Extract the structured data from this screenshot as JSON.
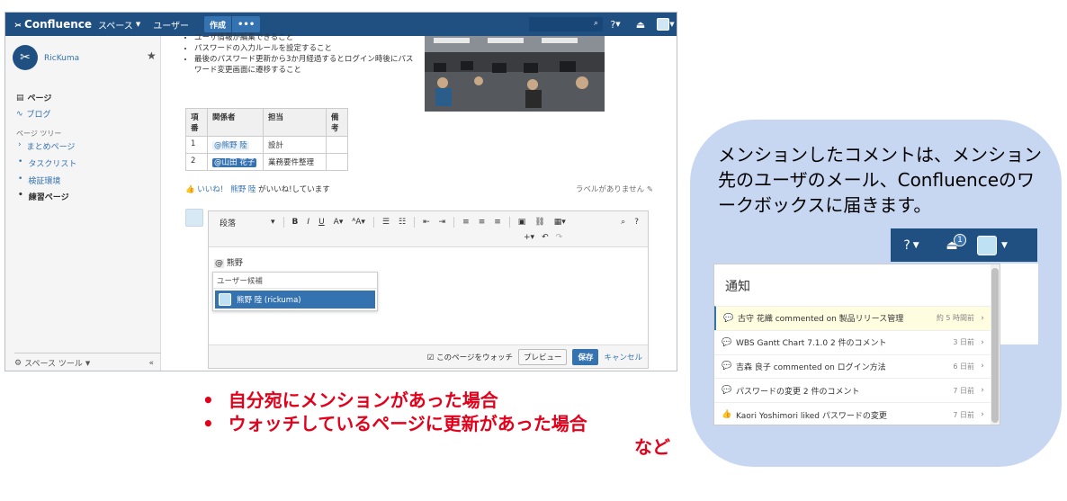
{
  "topbar": {
    "logo": "Confluence",
    "spaces": "スペース",
    "users": "ユーザー",
    "create": "作成",
    "more": "•••",
    "search_icon": "search-icon",
    "help": "?",
    "notifications_icon": "bell-icon"
  },
  "sidebar": {
    "space_name": "RicKuma",
    "pages": "ページ",
    "blog": "ブログ",
    "tree_title": "ページ ツリー",
    "tree_items": [
      "まとめページ",
      "タスクリスト",
      "検証環境",
      "練習ページ"
    ],
    "space_tools": "スペース ツール"
  },
  "content": {
    "bullets": [
      "ユーザ情報が編集できること",
      "パスワードの入力ルールを設定すること",
      "最後のパスワード更新から3か月経過するとログイン時後にパスワード変更画面に遷移すること"
    ],
    "table": {
      "headers": [
        "項番",
        "関係者",
        "担当",
        "備考"
      ],
      "rows": [
        {
          "no": "1",
          "person": "@熊野 陸",
          "role": "設計",
          "note": ""
        },
        {
          "no": "2",
          "person": "@山田 花子",
          "role": "業務要件整理",
          "note": ""
        }
      ]
    },
    "like": "いいね!",
    "liked_by": "熊野 陸",
    "liked_text": "がいいね!しています",
    "labels": "ラベルがありません"
  },
  "editor": {
    "style": "段落",
    "typed_at": "@",
    "typed_text": "熊野",
    "suggest_header": "ユーザー候補",
    "suggest_item": "熊野 陸 (rickuma)",
    "watch": "このページをウォッチ",
    "preview": "プレビュー",
    "save": "保存",
    "cancel": "キャンセル"
  },
  "notes": {
    "lines": [
      "自分宛にメンションがあった場合",
      "ウォッチしているページに更新があった場合"
    ],
    "tail": "など",
    "color": "#e3001b"
  },
  "callout": {
    "text": "メンションしたコメントは、メンション先のユーザのメール、Confluenceのワークボックスに届きます。",
    "bg": "#c7d7f1"
  },
  "notif_bar": {
    "help": "?",
    "badge": "1"
  },
  "notifications": {
    "title": "通知",
    "items": [
      {
        "icon": "comment-icon",
        "text": "古守 花織 commented on 製品リリース管理",
        "time": "約 5 時間前"
      },
      {
        "icon": "comment-icon",
        "text": "WBS Gantt Chart 7.1.0 2 件のコメント",
        "time": "3 日前"
      },
      {
        "icon": "comment-icon",
        "text": "吉森 良子 commented on ログイン方法",
        "time": "6 日前"
      },
      {
        "icon": "comment-icon",
        "text": "パスワードの変更 2 件のコメント",
        "time": "7 日前"
      },
      {
        "icon": "like-icon",
        "text": "Kaori Yoshimori liked パスワードの変更",
        "time": "7 日前"
      }
    ]
  },
  "colors": {
    "brand": "#205081",
    "accent": "#3572b0"
  }
}
